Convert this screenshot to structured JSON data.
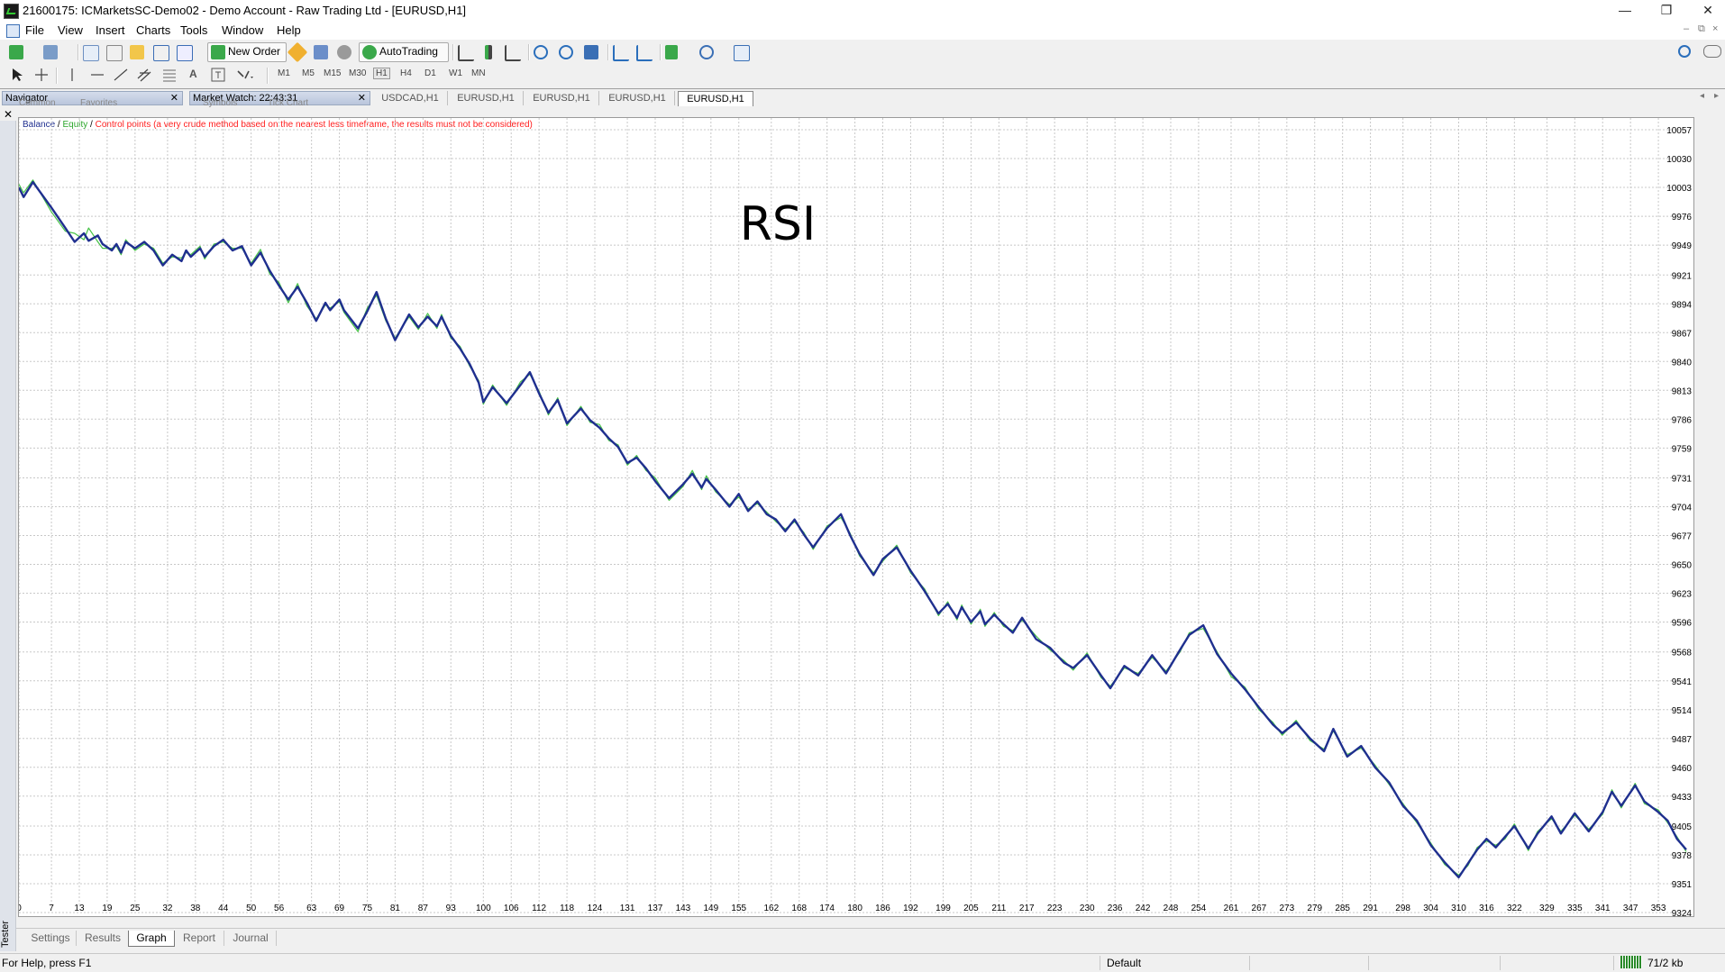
{
  "window": {
    "title": "21600175: ICMarketsSC-Demo02 - Demo Account - Raw Trading Ltd - [EURUSD,H1]",
    "minimize": "—",
    "restore": "❐",
    "close": "✕"
  },
  "menu": [
    "File",
    "View",
    "Insert",
    "Charts",
    "Tools",
    "Window",
    "Help"
  ],
  "toolbar": {
    "new_order": "New Order",
    "autotrading": "AutoTrading"
  },
  "timeframes": [
    "M1",
    "M5",
    "M15",
    "M30",
    "H1",
    "H4",
    "D1",
    "W1",
    "MN"
  ],
  "panels": {
    "navigator": "Navigator",
    "navigator_tabs": [
      "Common",
      "Favorites"
    ],
    "market_watch": "Market Watch: 22:43:31",
    "market_watch_tabs": [
      "Symbols",
      "Tick Chart"
    ]
  },
  "chart_tabs": [
    "USDCAD,H1",
    "EURUSD,H1",
    "EURUSD,H1",
    "EURUSD,H1",
    "EURUSD,H1"
  ],
  "active_chart_tab": 4,
  "legend": {
    "balance": "Balance",
    "equity": "Equity",
    "control": "Control points (a very crude method based on the nearest less timeframe, the results must not be considered)",
    "sep": " / "
  },
  "colors": {
    "balance": "#1f2f8f",
    "equity": "#46c246",
    "control": "#ff2020",
    "grid": "#c8c8c8"
  },
  "chart_data": {
    "type": "line",
    "title": "RSI",
    "xlabel": "",
    "ylabel": "",
    "grid": true,
    "legend_position": "top-left",
    "x_ticks": [
      0,
      7,
      13,
      19,
      25,
      32,
      38,
      44,
      50,
      56,
      63,
      69,
      75,
      81,
      87,
      93,
      100,
      106,
      112,
      118,
      124,
      131,
      137,
      143,
      149,
      155,
      162,
      168,
      174,
      180,
      186,
      192,
      199,
      205,
      211,
      217,
      223,
      230,
      236,
      242,
      248,
      254,
      261,
      267,
      273,
      279,
      285,
      291,
      298,
      304,
      310,
      316,
      322,
      329,
      335,
      341,
      347,
      353
    ],
    "y_ticks": [
      10057,
      10030,
      10003,
      9976,
      9949,
      9921,
      9894,
      9867,
      9840,
      9813,
      9786,
      9759,
      9731,
      9704,
      9677,
      9650,
      9623,
      9596,
      9568,
      9541,
      9514,
      9487,
      9460,
      9433,
      9405,
      9378,
      9351,
      9324
    ],
    "xlim": [
      0,
      359
    ],
    "ylim": [
      9324,
      10068
    ],
    "series": [
      {
        "name": "Balance",
        "x": [
          0,
          1,
          3,
          7,
          10,
          12,
          14,
          15,
          17,
          18,
          20,
          21,
          22,
          23,
          25,
          27,
          29,
          31,
          33,
          35,
          36,
          37,
          39,
          40,
          42,
          44,
          46,
          48,
          50,
          52,
          54,
          56,
          58,
          60,
          62,
          64,
          66,
          67,
          69,
          70,
          73,
          75,
          77,
          79,
          81,
          84,
          86,
          88,
          90,
          91,
          93,
          95,
          97,
          99,
          100,
          102,
          105,
          108,
          110,
          112,
          114,
          116,
          118,
          121,
          123,
          125,
          127,
          129,
          131,
          133,
          135,
          137,
          140,
          143,
          145,
          147,
          148,
          150,
          153,
          155,
          157,
          159,
          161,
          163,
          165,
          167,
          169,
          171,
          174,
          177,
          179,
          181,
          184,
          186,
          189,
          192,
          195,
          198,
          200,
          202,
          203,
          205,
          207,
          208,
          210,
          212,
          214,
          216,
          219,
          222,
          225,
          227,
          230,
          233,
          235,
          238,
          241,
          244,
          247,
          250,
          252,
          255,
          258,
          261,
          264,
          267,
          270,
          272,
          275,
          278,
          281,
          283,
          286,
          289,
          292,
          295,
          298,
          301,
          304,
          307,
          310,
          312,
          314,
          316,
          318,
          320,
          322,
          325,
          327,
          330,
          332,
          335,
          338,
          341,
          343,
          345,
          348,
          350,
          353,
          355,
          357,
          359
        ],
        "y": [
          10003,
          9994,
          10008,
          9984,
          9965,
          9952,
          9960,
          9953,
          9958,
          9950,
          9944,
          9950,
          9942,
          9952,
          9946,
          9952,
          9944,
          9930,
          9940,
          9934,
          9944,
          9938,
          9946,
          9938,
          9948,
          9954,
          9944,
          9948,
          9930,
          9942,
          9925,
          9911,
          9898,
          9910,
          9895,
          9878,
          9895,
          9888,
          9898,
          9888,
          9871,
          9887,
          9905,
          9880,
          9860,
          9884,
          9872,
          9882,
          9873,
          9882,
          9864,
          9852,
          9838,
          9820,
          9802,
          9816,
          9801,
          9818,
          9830,
          9810,
          9792,
          9804,
          9782,
          9796,
          9785,
          9778,
          9768,
          9760,
          9745,
          9750,
          9740,
          9728,
          9712,
          9725,
          9735,
          9722,
          9730,
          9720,
          9704,
          9716,
          9700,
          9709,
          9697,
          9692,
          9681,
          9692,
          9678,
          9666,
          9684,
          9697,
          9677,
          9660,
          9640,
          9655,
          9666,
          9644,
          9625,
          9604,
          9613,
          9600,
          9610,
          9596,
          9606,
          9594,
          9603,
          9594,
          9586,
          9600,
          9580,
          9572,
          9558,
          9553,
          9565,
          9546,
          9534,
          9555,
          9546,
          9565,
          9548,
          9570,
          9584,
          9593,
          9566,
          9548,
          9533,
          9516,
          9500,
          9492,
          9502,
          9487,
          9475,
          9496,
          9470,
          9480,
          9460,
          9446,
          9424,
          9410,
          9387,
          9371,
          9357,
          9370,
          9383,
          9393,
          9385,
          9395,
          9405,
          9384,
          9398,
          9414,
          9398,
          9417,
          9400,
          9418,
          9437,
          9424,
          9443,
          9428,
          9418,
          9410,
          9393,
          9383
        ]
      },
      {
        "name": "Equity",
        "x": [
          0,
          1,
          3,
          7,
          10,
          12,
          14,
          15,
          17,
          18,
          20,
          21,
          22,
          23,
          25,
          27,
          29,
          31,
          33,
          35,
          36,
          37,
          39,
          40,
          42,
          44,
          46,
          48,
          50,
          52,
          54,
          56,
          58,
          60,
          62,
          64,
          66,
          67,
          69,
          70,
          73,
          75,
          77,
          79,
          81,
          84,
          86,
          88,
          90,
          91,
          93,
          95,
          97,
          99,
          100,
          102,
          105,
          108,
          110,
          112,
          114,
          116,
          118,
          121,
          123,
          125,
          127,
          129,
          131,
          133,
          135,
          137,
          140,
          143,
          145,
          147,
          148,
          150,
          153,
          155,
          157,
          159,
          161,
          163,
          165,
          167,
          169,
          171,
          174,
          177,
          179,
          181,
          184,
          186,
          189,
          192,
          195,
          198,
          200,
          202,
          203,
          205,
          207,
          208,
          210,
          212,
          214,
          216,
          219,
          222,
          225,
          227,
          230,
          233,
          235,
          238,
          241,
          244,
          247,
          250,
          252,
          255,
          258,
          261,
          264,
          267,
          270,
          272,
          275,
          278,
          281,
          283,
          286,
          289,
          292,
          295,
          298,
          301,
          304,
          307,
          310,
          312,
          314,
          316,
          318,
          320,
          322,
          325,
          327,
          330,
          332,
          335,
          338,
          341,
          343,
          345,
          348,
          350,
          353,
          355,
          357,
          359
        ],
        "y": [
          10006,
          9998,
          10010,
          9980,
          9962,
          9960,
          9954,
          9965,
          9952,
          9946,
          9946,
          9948,
          9940,
          9954,
          9944,
          9950,
          9946,
          9932,
          9938,
          9937,
          9942,
          9940,
          9948,
          9936,
          9950,
          9952,
          9946,
          9946,
          9932,
          9945,
          9922,
          9914,
          9895,
          9913,
          9892,
          9880,
          9893,
          9890,
          9896,
          9886,
          9868,
          9890,
          9902,
          9878,
          9862,
          9882,
          9870,
          9885,
          9871,
          9884,
          9862,
          9854,
          9836,
          9822,
          9800,
          9818,
          9799,
          9821,
          9828,
          9812,
          9790,
          9806,
          9780,
          9798,
          9783,
          9781,
          9766,
          9762,
          9743,
          9752,
          9738,
          9731,
          9710,
          9723,
          9738,
          9720,
          9733,
          9718,
          9706,
          9713,
          9702,
          9707,
          9699,
          9690,
          9683,
          9690,
          9680,
          9664,
          9686,
          9694,
          9679,
          9658,
          9642,
          9653,
          9668,
          9642,
          9627,
          9602,
          9615,
          9598,
          9612,
          9594,
          9608,
          9592,
          9605,
          9592,
          9588,
          9598,
          9583,
          9570,
          9560,
          9551,
          9567,
          9544,
          9536,
          9553,
          9548,
          9563,
          9550,
          9568,
          9586,
          9590,
          9568,
          9545,
          9535,
          9514,
          9502,
          9490,
          9504,
          9485,
          9477,
          9494,
          9472,
          9478,
          9462,
          9444,
          9426,
          9408,
          9389,
          9369,
          9359,
          9368,
          9385,
          9391,
          9387,
          9393,
          9407,
          9382,
          9400,
          9412,
          9400,
          9415,
          9402,
          9416,
          9439,
          9422,
          9445,
          9426,
          9420,
          9408,
          9395,
          9381
        ]
      }
    ]
  },
  "bottom_tabs": [
    "Settings",
    "Results",
    "Graph",
    "Report",
    "Journal"
  ],
  "active_bottom_tab": 2,
  "tester_label": "Tester",
  "status": {
    "help": "For Help, press F1",
    "profile": "Default",
    "traffic": "71/2 kb"
  }
}
